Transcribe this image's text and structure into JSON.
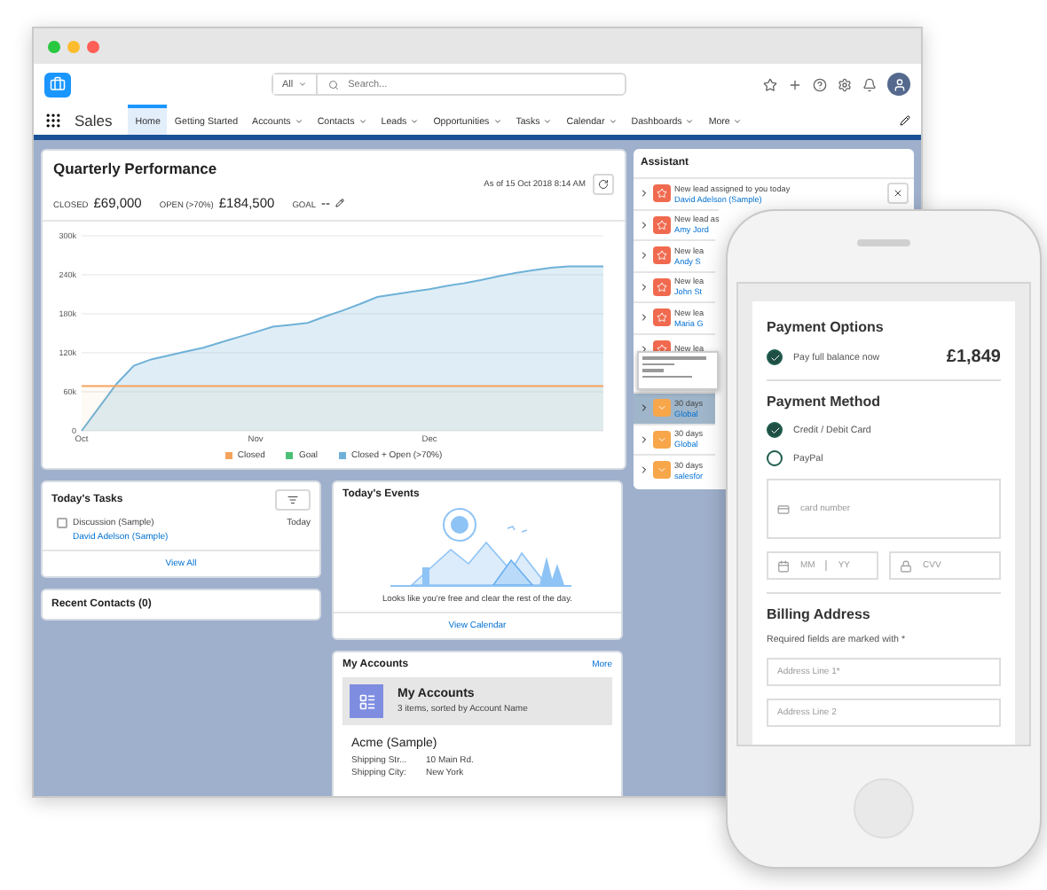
{
  "header": {
    "search_scope": "All",
    "search_placeholder": "Search..."
  },
  "nav": {
    "app_name": "Sales",
    "tabs": [
      {
        "label": "Home",
        "selected": true,
        "dropdown": false
      },
      {
        "label": "Getting Started",
        "selected": false,
        "dropdown": false
      },
      {
        "label": "Accounts",
        "selected": false,
        "dropdown": true
      },
      {
        "label": "Contacts",
        "selected": false,
        "dropdown": true
      },
      {
        "label": "Leads",
        "selected": false,
        "dropdown": true
      },
      {
        "label": "Opportunities",
        "selected": false,
        "dropdown": true
      },
      {
        "label": "Tasks",
        "selected": false,
        "dropdown": true
      },
      {
        "label": "Calendar",
        "selected": false,
        "dropdown": true
      },
      {
        "label": "Dashboards",
        "selected": false,
        "dropdown": true
      },
      {
        "label": "More",
        "selected": false,
        "dropdown": true
      }
    ]
  },
  "quarterly_performance": {
    "title": "Quarterly Performance",
    "as_of": "As of 15 Oct 2018 8:14 AM",
    "metrics": [
      {
        "label": "CLOSED",
        "value": "£69,000"
      },
      {
        "label": "OPEN (>70%)",
        "value": "£184,500"
      },
      {
        "label": "GOAL",
        "value": "--"
      }
    ],
    "chart_data": {
      "type": "area",
      "grid": true,
      "categories": [
        "Oct",
        null,
        null,
        null,
        null,
        null,
        null,
        null,
        null,
        null,
        "Nov",
        null,
        null,
        null,
        null,
        null,
        null,
        null,
        null,
        null,
        "Dec",
        null,
        null,
        null,
        null,
        null,
        null,
        null,
        null,
        null,
        null
      ],
      "ylim": [
        0,
        300000
      ],
      "yticks": [
        {
          "value": 0,
          "label": "0"
        },
        {
          "value": 60000,
          "label": "60k"
        },
        {
          "value": 120000,
          "label": "120k"
        },
        {
          "value": 180000,
          "label": "180k"
        },
        {
          "value": 240000,
          "label": "240k"
        },
        {
          "value": 300000,
          "label": "300k"
        }
      ],
      "series": [
        {
          "name": "Closed",
          "color": "#f5a35c",
          "values": [
            69000,
            69000,
            69000,
            69000,
            69000,
            69000,
            69000,
            69000,
            69000,
            69000,
            69000,
            69000,
            69000,
            69000,
            69000,
            69000,
            69000,
            69000,
            69000,
            69000,
            69000,
            69000,
            69000,
            69000,
            69000,
            69000,
            69000,
            69000,
            69000,
            69000,
            69000
          ]
        },
        {
          "name": "Goal",
          "color": "#4bc076",
          "values": [
            null,
            null,
            null,
            null,
            null,
            null,
            null,
            null,
            null,
            null,
            null,
            null,
            null,
            null,
            null,
            null,
            null,
            null,
            null,
            null,
            null,
            null,
            null,
            null,
            null,
            null,
            null,
            null,
            null,
            null,
            null
          ]
        },
        {
          "name": "Closed + Open (>70%)",
          "color": "#6fb1d8",
          "values": [
            0,
            36000,
            72000,
            100000,
            110000,
            116000,
            122000,
            128000,
            136000,
            144000,
            152000,
            160000,
            163000,
            166000,
            176000,
            185000,
            195000,
            206000,
            210000,
            214000,
            218000,
            223000,
            227000,
            232000,
            238000,
            243000,
            247000,
            251000,
            253000,
            253000,
            253000
          ]
        }
      ]
    }
  },
  "todays_tasks": {
    "title": "Today's Tasks",
    "tasks": [
      {
        "subject": "Discussion (Sample)",
        "contact": "David Adelson (Sample)",
        "due": "Today",
        "checked": false
      }
    ],
    "link": "View All"
  },
  "recent_contacts": {
    "title": "Recent Contacts (0)"
  },
  "todays_events": {
    "title": "Today's Events",
    "message": "Looks like you're free and clear the rest of the day.",
    "link": "View Calendar"
  },
  "my_accounts": {
    "title": "My Accounts",
    "more": "More",
    "list_title": "My Accounts",
    "list_subtitle": "3 items, sorted by Account Name",
    "accounts": [
      {
        "name": "Acme (Sample)",
        "fields": [
          {
            "label": "Shipping Str...",
            "value": "10 Main Rd."
          },
          {
            "label": "Shipping City:",
            "value": "New York"
          }
        ]
      }
    ]
  },
  "assistant": {
    "title": "Assistant",
    "items": [
      {
        "kind": "lead",
        "title": "New lead assigned to you today",
        "link": "David Adelson (Sample)",
        "selected": false,
        "dismissible": true
      },
      {
        "kind": "lead",
        "title": "New lead as",
        "link": "Amy Jord",
        "selected": false,
        "dismissible": false
      },
      {
        "kind": "lead",
        "title": "New lea",
        "link": "Andy S",
        "selected": false,
        "dismissible": false
      },
      {
        "kind": "lead",
        "title": "New lea",
        "link": "John St",
        "selected": false,
        "dismissible": false
      },
      {
        "kind": "lead",
        "title": "New lea",
        "link": "Maria G",
        "selected": false,
        "dismissible": false
      },
      {
        "kind": "lead",
        "title": "New lea",
        "selected": false,
        "dismissible": false
      },
      {
        "kind": "opportunity",
        "title": "30 days",
        "link": "Global",
        "selected": true,
        "dismissible": false
      },
      {
        "kind": "opportunity",
        "title": "30 days",
        "link": "Global",
        "selected": false,
        "dismissible": false
      },
      {
        "kind": "opportunity",
        "title": "30 days",
        "link": "salesfor",
        "selected": false,
        "dismissible": false
      }
    ]
  },
  "phone": {
    "payment_options": {
      "title": "Payment Options",
      "option": {
        "label": "Pay full balance now",
        "checked": true
      },
      "amount": "£1,849"
    },
    "payment_method": {
      "title": "Payment Method",
      "methods": [
        {
          "label": "Credit / Debit Card",
          "selected": true
        },
        {
          "label": "PayPal",
          "selected": false
        }
      ],
      "card_number_placeholder": "card number",
      "month_placeholder": "MM",
      "year_placeholder": "YY",
      "cvv_placeholder": "CVV"
    },
    "billing_address": {
      "title": "Billing Address",
      "note": "Required fields are marked with *",
      "fields": [
        {
          "placeholder": "Address Line 1*"
        },
        {
          "placeholder": "Address Line 2"
        }
      ]
    }
  }
}
